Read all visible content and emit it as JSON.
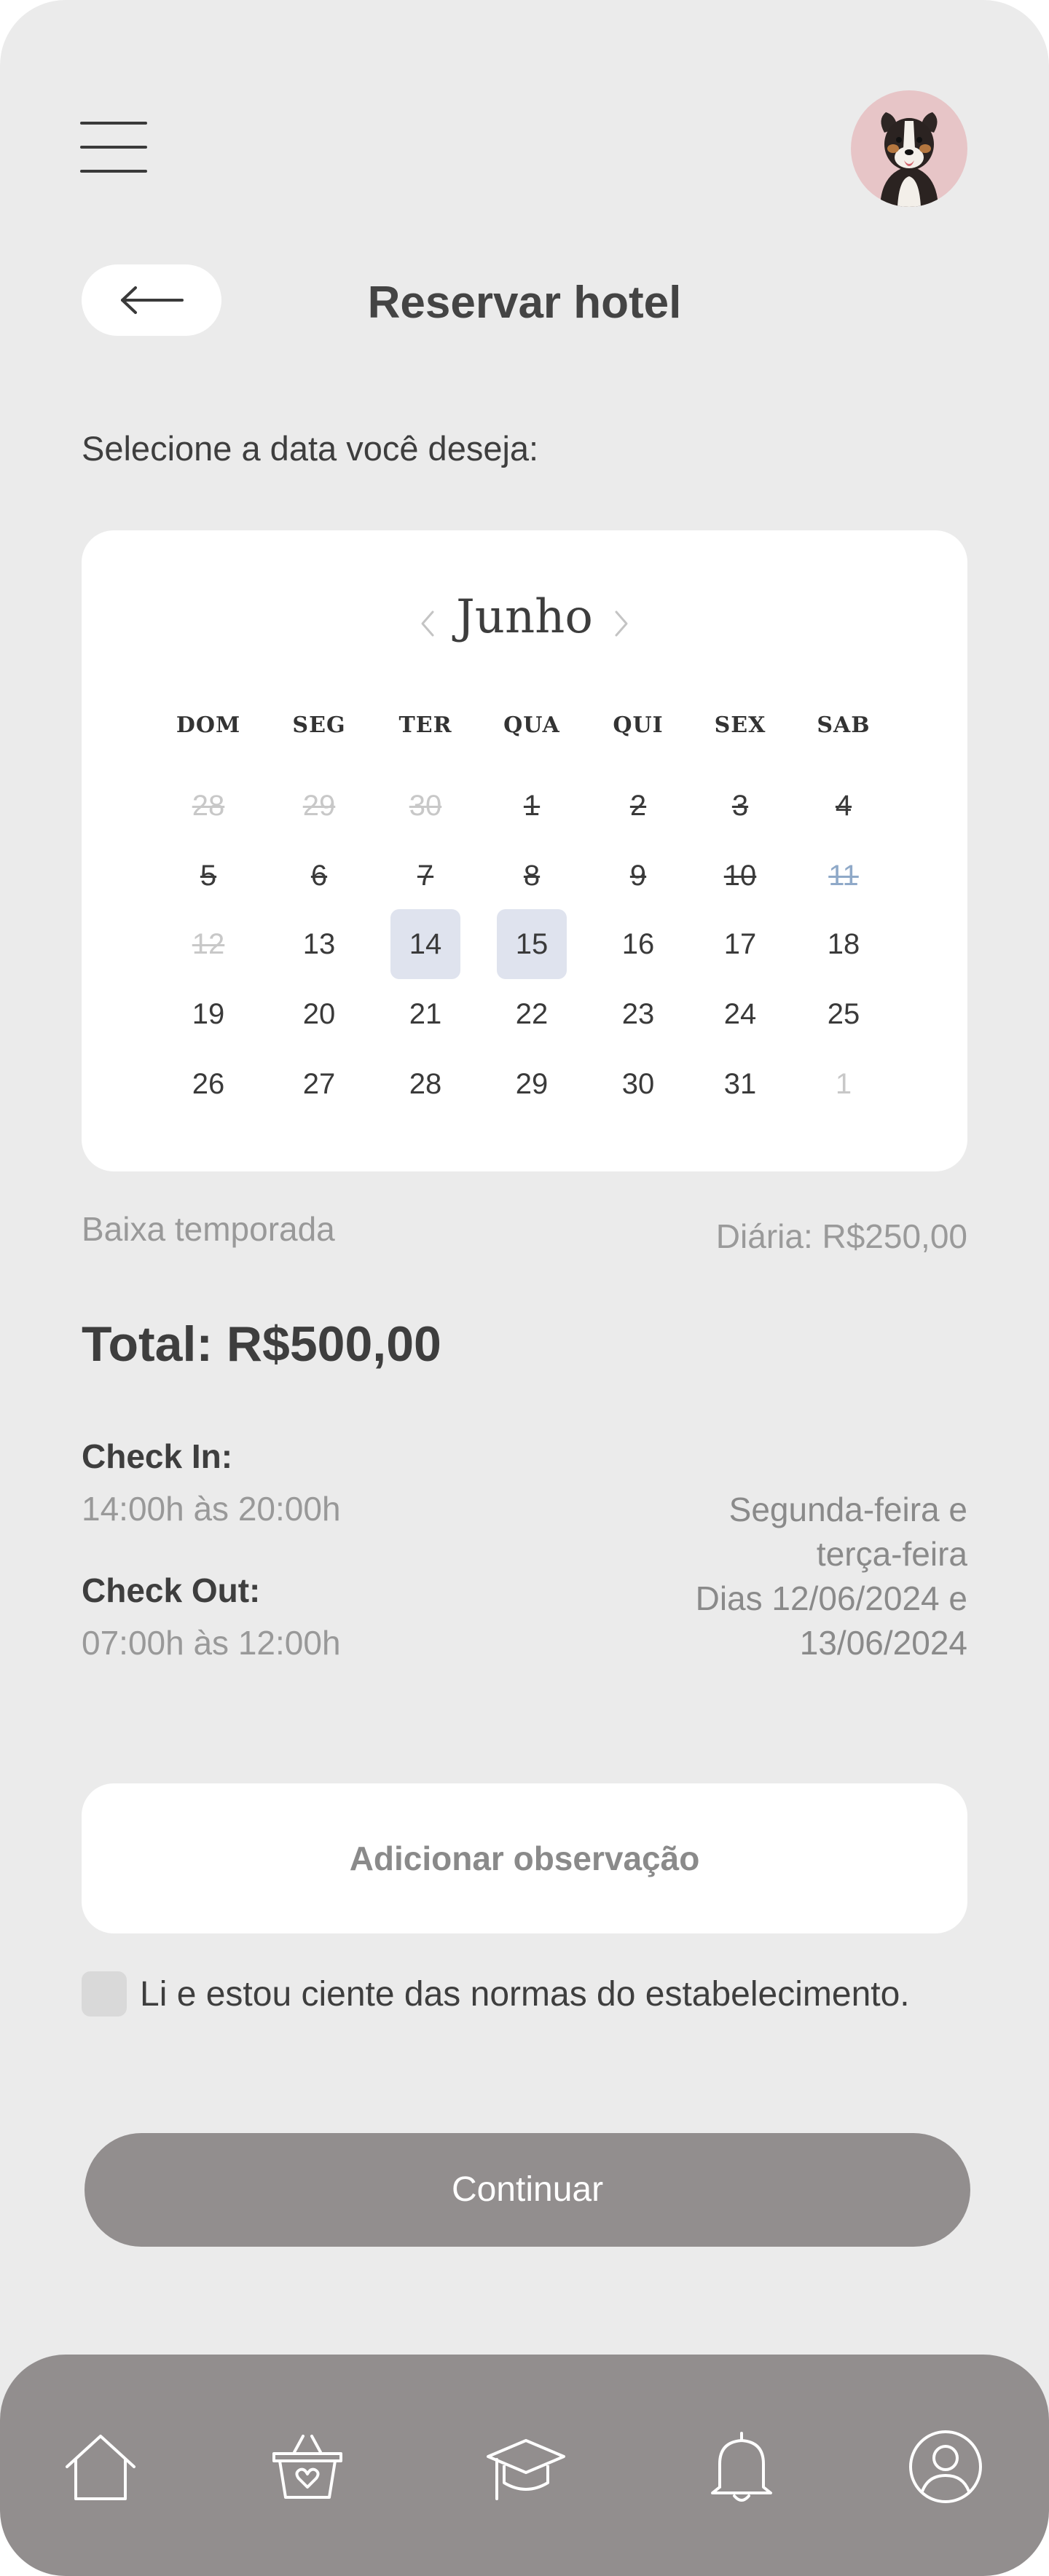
{
  "header": {
    "menu_icon": "hamburger-menu-icon",
    "avatar_icon": "dog-avatar",
    "back_icon": "arrow-left-icon",
    "title": "Reservar hotel"
  },
  "prompt": "Selecione a data você deseja:",
  "calendar": {
    "month": "Junho",
    "prev_icon": "chevron-left-icon",
    "next_icon": "chevron-right-icon",
    "weekdays": [
      "DOM",
      "SEG",
      "TER",
      "QUA",
      "QUI",
      "SEX",
      "SAB"
    ],
    "weeks": [
      [
        {
          "d": "28",
          "s": "struck-muted"
        },
        {
          "d": "29",
          "s": "struck-muted"
        },
        {
          "d": "30",
          "s": "struck-muted"
        },
        {
          "d": "1",
          "s": "struck"
        },
        {
          "d": "2",
          "s": "struck"
        },
        {
          "d": "3",
          "s": "struck"
        },
        {
          "d": "4",
          "s": "struck"
        }
      ],
      [
        {
          "d": "5",
          "s": "struck"
        },
        {
          "d": "6",
          "s": "struck"
        },
        {
          "d": "7",
          "s": "struck"
        },
        {
          "d": "8",
          "s": "struck"
        },
        {
          "d": "9",
          "s": "struck"
        },
        {
          "d": "10",
          "s": "struck"
        },
        {
          "d": "11",
          "s": "struck-blue"
        }
      ],
      [
        {
          "d": "12",
          "s": "struck-muted"
        },
        {
          "d": "13",
          "s": "normal"
        },
        {
          "d": "14",
          "s": "selected"
        },
        {
          "d": "15",
          "s": "selected"
        },
        {
          "d": "16",
          "s": "normal"
        },
        {
          "d": "17",
          "s": "normal"
        },
        {
          "d": "18",
          "s": "normal"
        }
      ],
      [
        {
          "d": "19",
          "s": "normal"
        },
        {
          "d": "20",
          "s": "normal"
        },
        {
          "d": "21",
          "s": "normal"
        },
        {
          "d": "22",
          "s": "normal"
        },
        {
          "d": "23",
          "s": "normal"
        },
        {
          "d": "24",
          "s": "normal"
        },
        {
          "d": "25",
          "s": "normal"
        }
      ],
      [
        {
          "d": "26",
          "s": "normal"
        },
        {
          "d": "27",
          "s": "normal"
        },
        {
          "d": "28",
          "s": "normal"
        },
        {
          "d": "29",
          "s": "normal"
        },
        {
          "d": "30",
          "s": "normal"
        },
        {
          "d": "31",
          "s": "normal"
        },
        {
          "d": "1",
          "s": "muted"
        }
      ]
    ]
  },
  "pricing": {
    "season": "Baixa temporada",
    "daily_rate": "Diária: R$250,00",
    "total": "Total: R$500,00"
  },
  "schedule": {
    "checkin_label": "Check In:",
    "checkin_time": "14:00h às 20:00h",
    "checkout_label": "Check Out:",
    "checkout_time": "07:00h às 12:00h",
    "days_line1": "Segunda-feira e",
    "days_line2": "terça-feira",
    "dates_line1": "Dias 12/06/2024 e",
    "dates_line2": "13/06/2024"
  },
  "observation_button": "Adicionar observação",
  "terms": {
    "checked": false,
    "label": "Li e estou ciente das normas do estabelecimento."
  },
  "continue_button": "Continuar",
  "bottom_nav": [
    "home-icon",
    "basket-heart-icon",
    "graduation-cap-icon",
    "bell-icon",
    "user-profile-icon"
  ],
  "colors": {
    "background": "#ebebeb",
    "card": "#ffffff",
    "selected_day": "#dfe3ee",
    "primary_button": "#928e8e",
    "nav_bar": "#928e8e",
    "avatar_bg": "#e7c5c7"
  }
}
